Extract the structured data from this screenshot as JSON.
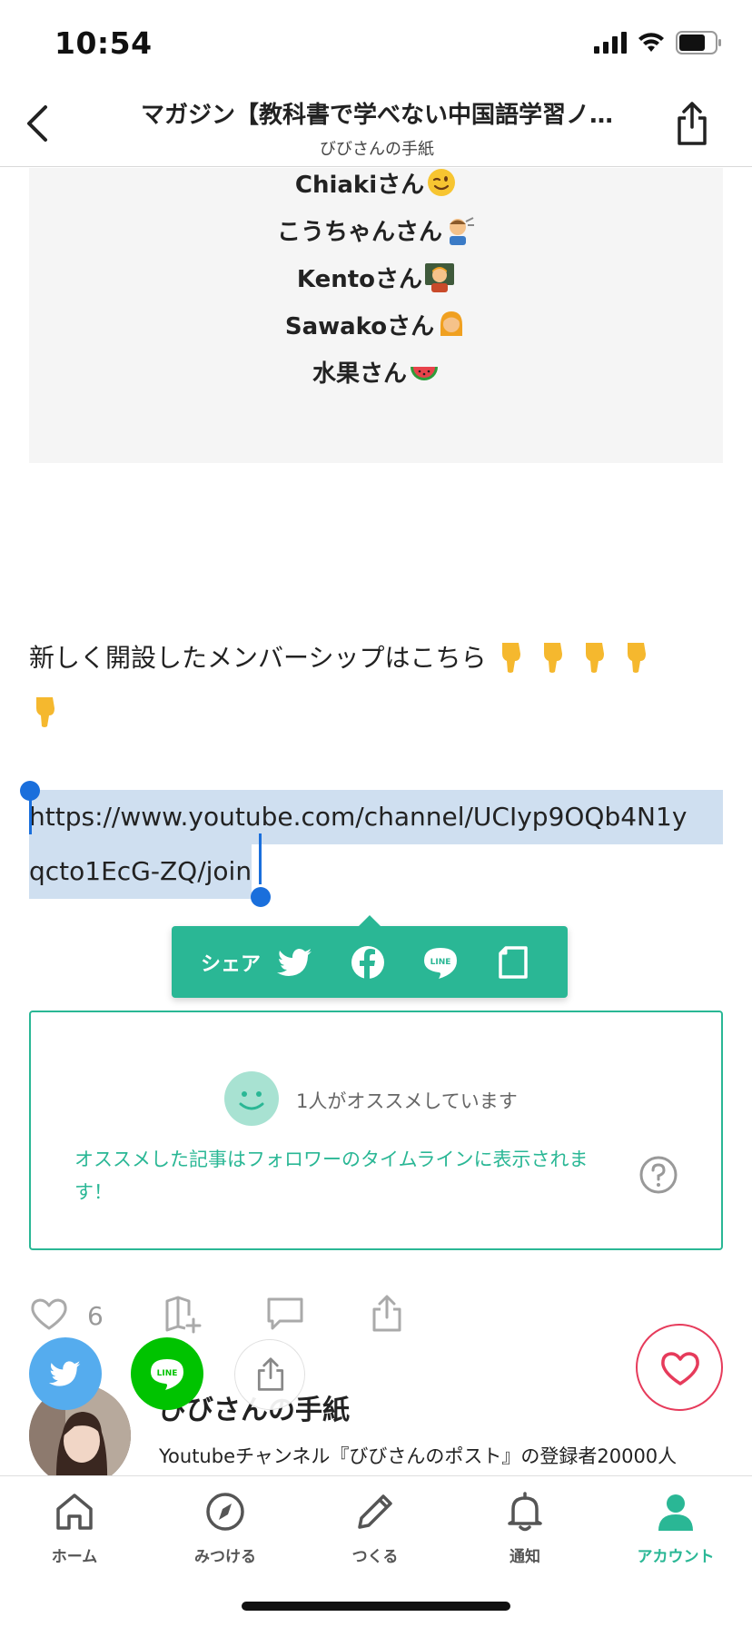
{
  "status_bar": {
    "time": "10:54"
  },
  "nav": {
    "title": "マガジン【教科書で学べない中国語学習ノ…",
    "subtitle": "びびさんの手紙"
  },
  "supporters": [
    {
      "name": "Chiakiさん",
      "emoji": "winking-face-emoji"
    },
    {
      "name": "こうちゃんさん",
      "emoji": "farmer-emoji"
    },
    {
      "name": "Kentoさん",
      "emoji": "teacher-emoji"
    },
    {
      "name": "Sawakoさん",
      "emoji": "woman-emoji"
    },
    {
      "name": "水果さん",
      "emoji": "watermelon-emoji"
    }
  ],
  "body_text": "新しく開設したメンバーシップはこちら",
  "link": {
    "line1": "https://www.youtube.com/channel/UCIyp9OQb4N1y",
    "line2": "qcto1EcG-ZQ/join"
  },
  "share_popup": {
    "label": "シェア",
    "icons": [
      "twitter-icon",
      "facebook-icon",
      "line-icon",
      "note-icon"
    ]
  },
  "recommend": {
    "count_text": "1人がオススメしています",
    "description": "オススメした記事はフォロワーのタイムラインに表示されます！"
  },
  "actions": {
    "like_count": "6"
  },
  "author": {
    "name": "びびさんの手紙",
    "description": "Youtubeチャンネル『びびさんのポスト』の登録者20000人"
  },
  "tab_bar": [
    {
      "label": "ホーム",
      "icon": "home-icon",
      "active": false
    },
    {
      "label": "みつける",
      "icon": "compass-icon",
      "active": false
    },
    {
      "label": "つくる",
      "icon": "pencil-icon",
      "active": false
    },
    {
      "label": "通知",
      "icon": "bell-icon",
      "active": false
    },
    {
      "label": "アカウント",
      "icon": "person-icon",
      "active": true
    }
  ],
  "colors": {
    "accent": "#2ab795",
    "selection": "#cfdff0",
    "heart": "#e63b5b",
    "twitter": "#55acee",
    "line": "#00c300"
  }
}
